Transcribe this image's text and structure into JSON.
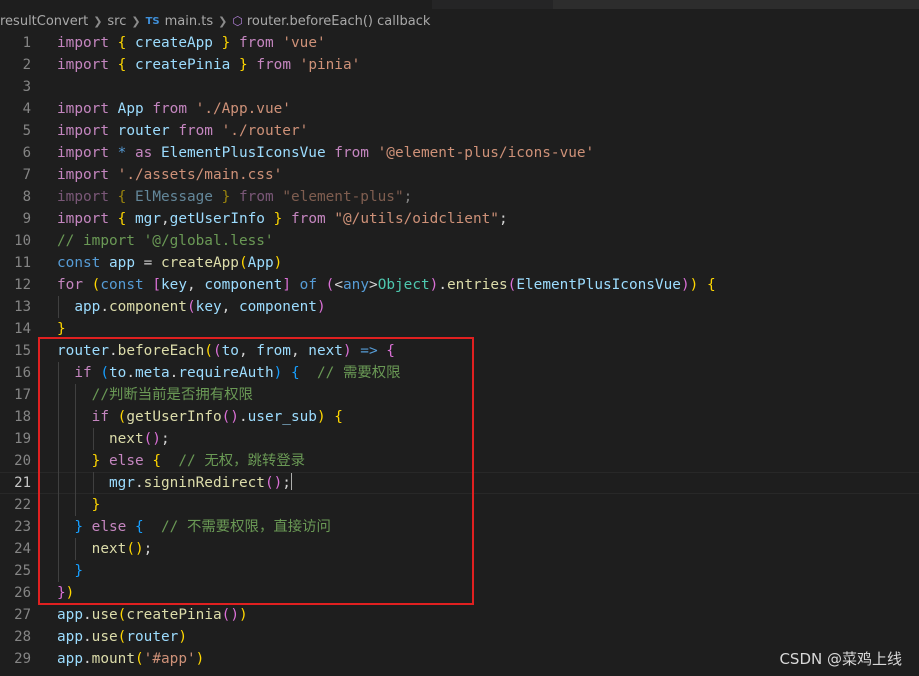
{
  "breadcrumb": {
    "folder1": "resultConvert",
    "folder2": "src",
    "file_icon": "TS",
    "file": "main.ts",
    "symbol": "router.beforeEach() callback"
  },
  "editor": {
    "language": "typescript",
    "current_line": 21,
    "highlight_box_color": "#e02020",
    "lines": [
      {
        "n": 1,
        "tokens": [
          [
            "kw",
            "import"
          ],
          [
            "pn",
            " "
          ],
          [
            "b1",
            "{"
          ],
          [
            "pn",
            " "
          ],
          [
            "va",
            "createApp"
          ],
          [
            "pn",
            " "
          ],
          [
            "b1",
            "}"
          ],
          [
            "pn",
            " "
          ],
          [
            "kw",
            "from"
          ],
          [
            "pn",
            " "
          ],
          [
            "str",
            "'vue'"
          ]
        ]
      },
      {
        "n": 2,
        "tokens": [
          [
            "kw",
            "import"
          ],
          [
            "pn",
            " "
          ],
          [
            "b1",
            "{"
          ],
          [
            "pn",
            " "
          ],
          [
            "va",
            "createPinia"
          ],
          [
            "pn",
            " "
          ],
          [
            "b1",
            "}"
          ],
          [
            "pn",
            " "
          ],
          [
            "kw",
            "from"
          ],
          [
            "pn",
            " "
          ],
          [
            "str",
            "'pinia'"
          ]
        ]
      },
      {
        "n": 3,
        "tokens": []
      },
      {
        "n": 4,
        "tokens": [
          [
            "kw",
            "import"
          ],
          [
            "pn",
            " "
          ],
          [
            "va",
            "App"
          ],
          [
            "pn",
            " "
          ],
          [
            "kw",
            "from"
          ],
          [
            "pn",
            " "
          ],
          [
            "str",
            "'./App.vue'"
          ]
        ]
      },
      {
        "n": 5,
        "tokens": [
          [
            "kw",
            "import"
          ],
          [
            "pn",
            " "
          ],
          [
            "va",
            "router"
          ],
          [
            "pn",
            " "
          ],
          [
            "kw",
            "from"
          ],
          [
            "pn",
            " "
          ],
          [
            "str",
            "'./router'"
          ]
        ]
      },
      {
        "n": 6,
        "tokens": [
          [
            "kw",
            "import"
          ],
          [
            "pn",
            " "
          ],
          [
            "st",
            "*"
          ],
          [
            "pn",
            " "
          ],
          [
            "kw",
            "as"
          ],
          [
            "pn",
            " "
          ],
          [
            "va",
            "ElementPlusIconsVue"
          ],
          [
            "pn",
            " "
          ],
          [
            "kw",
            "from"
          ],
          [
            "pn",
            " "
          ],
          [
            "str",
            "'@element-plus/icons-vue'"
          ]
        ]
      },
      {
        "n": 7,
        "tokens": [
          [
            "kw",
            "import"
          ],
          [
            "pn",
            " "
          ],
          [
            "str",
            "'./assets/main.css'"
          ]
        ]
      },
      {
        "n": 8,
        "dim": true,
        "tokens": [
          [
            "kw",
            "import"
          ],
          [
            "pn",
            " "
          ],
          [
            "b1",
            "{"
          ],
          [
            "pn",
            " "
          ],
          [
            "va",
            "ElMessage"
          ],
          [
            "pn",
            " "
          ],
          [
            "b1",
            "}"
          ],
          [
            "pn",
            " "
          ],
          [
            "kw",
            "from"
          ],
          [
            "pn",
            " "
          ],
          [
            "str",
            "\"element-plus\""
          ],
          [
            "pn",
            ";"
          ]
        ]
      },
      {
        "n": 9,
        "tokens": [
          [
            "kw",
            "import"
          ],
          [
            "pn",
            " "
          ],
          [
            "b1",
            "{"
          ],
          [
            "pn",
            " "
          ],
          [
            "va",
            "mgr"
          ],
          [
            "pn",
            ","
          ],
          [
            "va",
            "getUserInfo"
          ],
          [
            "pn",
            " "
          ],
          [
            "b1",
            "}"
          ],
          [
            "pn",
            " "
          ],
          [
            "kw",
            "from"
          ],
          [
            "pn",
            " "
          ],
          [
            "str",
            "\"@/utils/oidclient\""
          ],
          [
            "pn",
            ";"
          ]
        ]
      },
      {
        "n": 10,
        "tokens": [
          [
            "cm",
            "// import '@/global.less'"
          ]
        ]
      },
      {
        "n": 11,
        "tokens": [
          [
            "st",
            "const"
          ],
          [
            "pn",
            " "
          ],
          [
            "va",
            "app"
          ],
          [
            "pn",
            " = "
          ],
          [
            "fn",
            "createApp"
          ],
          [
            "b1",
            "("
          ],
          [
            "va",
            "App"
          ],
          [
            "b1",
            ")"
          ]
        ]
      },
      {
        "n": 12,
        "tokens": [
          [
            "kw",
            "for"
          ],
          [
            "pn",
            " "
          ],
          [
            "b1",
            "("
          ],
          [
            "st",
            "const"
          ],
          [
            "pn",
            " "
          ],
          [
            "b2",
            "["
          ],
          [
            "va",
            "key"
          ],
          [
            "pn",
            ", "
          ],
          [
            "va",
            "component"
          ],
          [
            "b2",
            "]"
          ],
          [
            "pn",
            " "
          ],
          [
            "st",
            "of"
          ],
          [
            "pn",
            " "
          ],
          [
            "b2",
            "("
          ],
          [
            "pn",
            "<"
          ],
          [
            "st",
            "any"
          ],
          [
            "pn",
            ">"
          ],
          [
            "cls",
            "Object"
          ],
          [
            "b2",
            ")"
          ],
          [
            "pn",
            "."
          ],
          [
            "fn",
            "entries"
          ],
          [
            "b2",
            "("
          ],
          [
            "va",
            "ElementPlusIconsVue"
          ],
          [
            "b2",
            ")"
          ],
          [
            "b1",
            ")"
          ],
          [
            "pn",
            " "
          ],
          [
            "b1",
            "{"
          ]
        ]
      },
      {
        "n": 13,
        "guides": [
          1
        ],
        "tokens": [
          [
            "pn",
            "  "
          ],
          [
            "va",
            "app"
          ],
          [
            "pn",
            "."
          ],
          [
            "fn",
            "component"
          ],
          [
            "b2",
            "("
          ],
          [
            "va",
            "key"
          ],
          [
            "pn",
            ", "
          ],
          [
            "va",
            "component"
          ],
          [
            "b2",
            ")"
          ]
        ]
      },
      {
        "n": 14,
        "tokens": [
          [
            "b1",
            "}"
          ]
        ]
      },
      {
        "n": 15,
        "tokens": [
          [
            "va",
            "router"
          ],
          [
            "pn",
            "."
          ],
          [
            "fn",
            "beforeEach"
          ],
          [
            "b1",
            "("
          ],
          [
            "b2",
            "("
          ],
          [
            "va",
            "to"
          ],
          [
            "pn",
            ", "
          ],
          [
            "va",
            "from"
          ],
          [
            "pn",
            ", "
          ],
          [
            "va",
            "next"
          ],
          [
            "b2",
            ")"
          ],
          [
            "pn",
            " "
          ],
          [
            "st",
            "=>"
          ],
          [
            "pn",
            " "
          ],
          [
            "b2",
            "{"
          ]
        ]
      },
      {
        "n": 16,
        "guides": [
          1
        ],
        "tokens": [
          [
            "pn",
            "  "
          ],
          [
            "kw",
            "if"
          ],
          [
            "pn",
            " "
          ],
          [
            "b3",
            "("
          ],
          [
            "va",
            "to"
          ],
          [
            "pn",
            "."
          ],
          [
            "va",
            "meta"
          ],
          [
            "pn",
            "."
          ],
          [
            "va",
            "requireAuth"
          ],
          [
            "b3",
            ")"
          ],
          [
            "pn",
            " "
          ],
          [
            "b3",
            "{"
          ],
          [
            "pn",
            "  "
          ],
          [
            "cm",
            "// 需要权限"
          ]
        ]
      },
      {
        "n": 17,
        "guides": [
          1,
          2
        ],
        "tokens": [
          [
            "pn",
            "    "
          ],
          [
            "cm",
            "//判断当前是否拥有权限"
          ]
        ]
      },
      {
        "n": 18,
        "guides": [
          1,
          2
        ],
        "tokens": [
          [
            "pn",
            "    "
          ],
          [
            "kw",
            "if"
          ],
          [
            "pn",
            " "
          ],
          [
            "b1",
            "("
          ],
          [
            "fn",
            "getUserInfo"
          ],
          [
            "b2",
            "()"
          ],
          [
            "pn",
            "."
          ],
          [
            "va",
            "user_sub"
          ],
          [
            "b1",
            ")"
          ],
          [
            "pn",
            " "
          ],
          [
            "b1",
            "{"
          ]
        ]
      },
      {
        "n": 19,
        "guides": [
          1,
          2,
          3
        ],
        "tokens": [
          [
            "pn",
            "      "
          ],
          [
            "fn",
            "next"
          ],
          [
            "b2",
            "()"
          ],
          [
            "pn",
            ";"
          ]
        ]
      },
      {
        "n": 20,
        "guides": [
          1,
          2
        ],
        "tokens": [
          [
            "pn",
            "    "
          ],
          [
            "b1",
            "}"
          ],
          [
            "pn",
            " "
          ],
          [
            "kw",
            "else"
          ],
          [
            "pn",
            " "
          ],
          [
            "b1",
            "{"
          ],
          [
            "pn",
            "  "
          ],
          [
            "cm",
            "// 无权，跳转登录"
          ]
        ]
      },
      {
        "n": 21,
        "guides": [
          1,
          2,
          3
        ],
        "cursor": true,
        "tokens": [
          [
            "pn",
            "      "
          ],
          [
            "va",
            "mgr"
          ],
          [
            "pn",
            "."
          ],
          [
            "fn",
            "signinRedirect"
          ],
          [
            "b2",
            "()"
          ],
          [
            "pn",
            ";"
          ]
        ]
      },
      {
        "n": 22,
        "guides": [
          1,
          2
        ],
        "tokens": [
          [
            "pn",
            "    "
          ],
          [
            "b1",
            "}"
          ]
        ]
      },
      {
        "n": 23,
        "guides": [
          1
        ],
        "tokens": [
          [
            "pn",
            "  "
          ],
          [
            "b3",
            "}"
          ],
          [
            "pn",
            " "
          ],
          [
            "kw",
            "else"
          ],
          [
            "pn",
            " "
          ],
          [
            "b3",
            "{"
          ],
          [
            "pn",
            "  "
          ],
          [
            "cm",
            "// 不需要权限，直接访问"
          ]
        ]
      },
      {
        "n": 24,
        "guides": [
          1,
          2
        ],
        "tokens": [
          [
            "pn",
            "    "
          ],
          [
            "fn",
            "next"
          ],
          [
            "b1",
            "()"
          ],
          [
            "pn",
            ";"
          ]
        ]
      },
      {
        "n": 25,
        "guides": [
          1
        ],
        "tokens": [
          [
            "pn",
            "  "
          ],
          [
            "b3",
            "}"
          ]
        ]
      },
      {
        "n": 26,
        "tokens": [
          [
            "b2",
            "}"
          ],
          [
            "b1",
            ")"
          ]
        ]
      },
      {
        "n": 27,
        "tokens": [
          [
            "va",
            "app"
          ],
          [
            "pn",
            "."
          ],
          [
            "fn",
            "use"
          ],
          [
            "b1",
            "("
          ],
          [
            "fn",
            "createPinia"
          ],
          [
            "b2",
            "()"
          ],
          [
            "b1",
            ")"
          ]
        ]
      },
      {
        "n": 28,
        "tokens": [
          [
            "va",
            "app"
          ],
          [
            "pn",
            "."
          ],
          [
            "fn",
            "use"
          ],
          [
            "b1",
            "("
          ],
          [
            "va",
            "router"
          ],
          [
            "b1",
            ")"
          ]
        ]
      },
      {
        "n": 29,
        "tokens": [
          [
            "va",
            "app"
          ],
          [
            "pn",
            "."
          ],
          [
            "fn",
            "mount"
          ],
          [
            "b1",
            "("
          ],
          [
            "str",
            "'#app'"
          ],
          [
            "b1",
            ")"
          ]
        ]
      }
    ]
  },
  "watermark": "CSDN @菜鸡上线"
}
